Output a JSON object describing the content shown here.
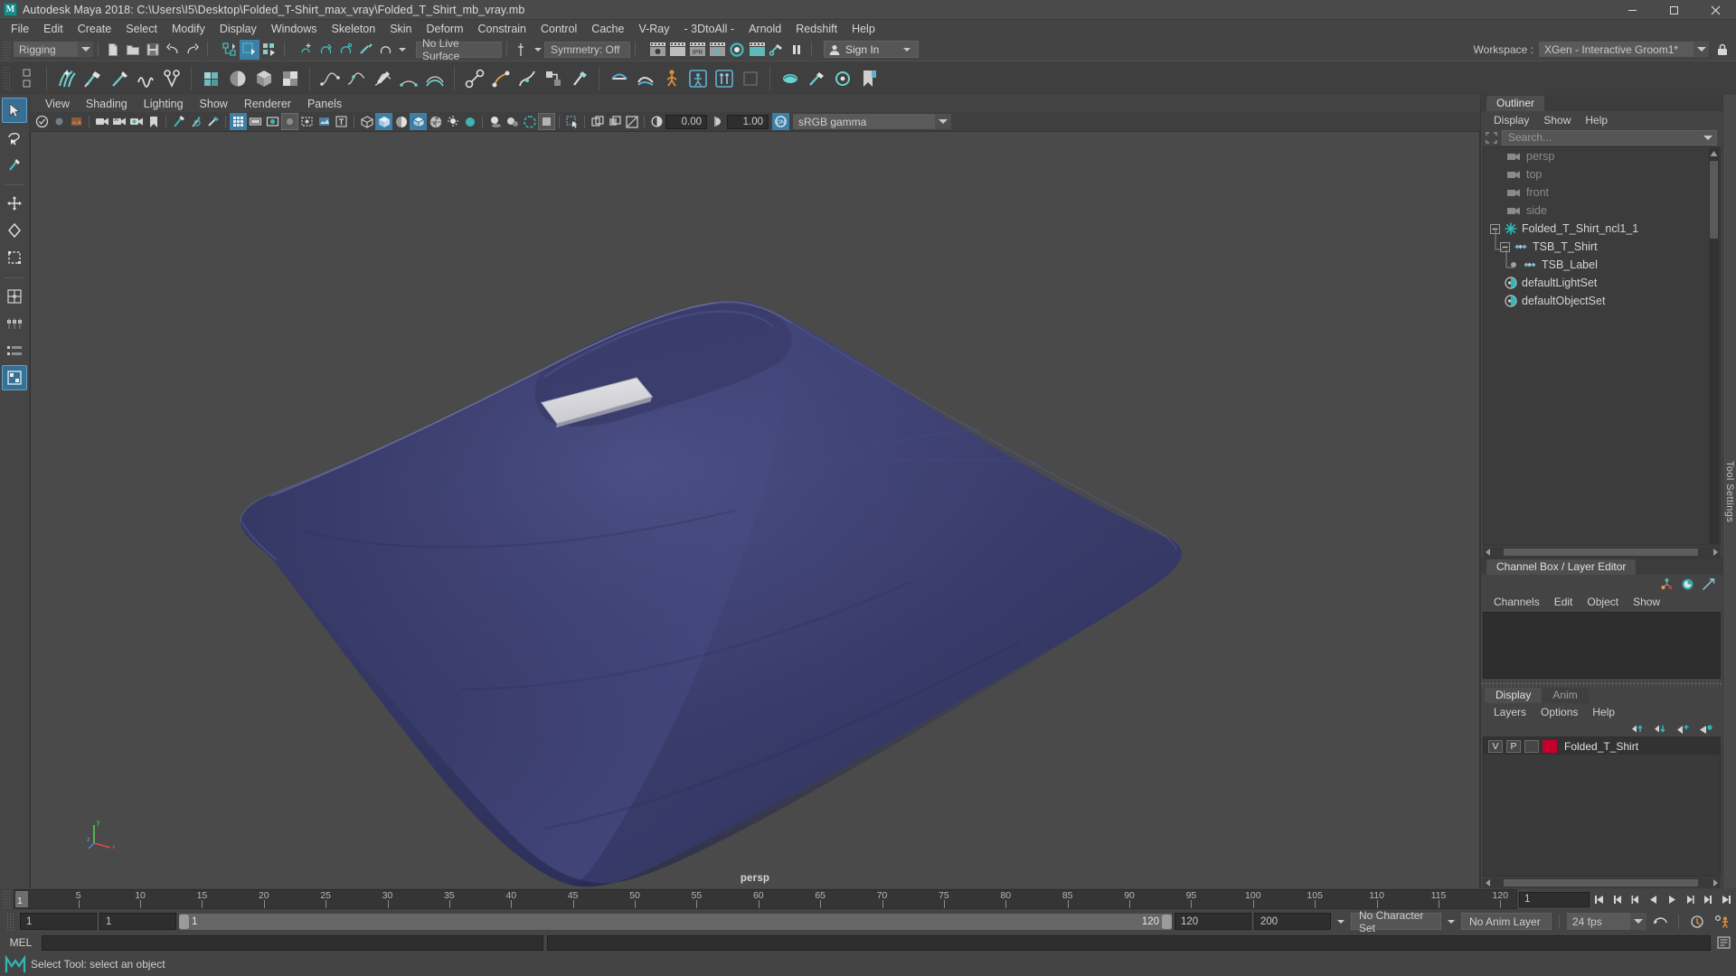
{
  "window": {
    "title": "Autodesk Maya 2018: C:\\Users\\I5\\Desktop\\Folded_T-Shirt_max_vray\\Folded_T_Shirt_mb_vray.mb",
    "logo": "M",
    "minimize": "minimize-icon",
    "maximize": "maximize-icon",
    "close": "close-icon"
  },
  "menubar": {
    "items": [
      "File",
      "Edit",
      "Create",
      "Select",
      "Modify",
      "Display",
      "Windows",
      "Skeleton",
      "Skin",
      "Deform",
      "Constrain",
      "Control",
      "Cache",
      "V-Ray",
      "- 3DtoAll -",
      "Arnold",
      "Redshift",
      "Help"
    ]
  },
  "statusline": {
    "menu_set": "Rigging",
    "live_surface": "No Live Surface",
    "symmetry": "Symmetry: Off",
    "sign_in": "Sign In",
    "workspace_label": "Workspace :",
    "workspace_value": "XGen - Interactive Groom1*"
  },
  "viewport": {
    "menus": [
      "View",
      "Shading",
      "Lighting",
      "Show",
      "Renderer",
      "Panels"
    ],
    "exposure": "0.00",
    "gamma": "1.00",
    "color_management": "sRGB gamma",
    "camera_label": "persp",
    "axis": {
      "x": "x",
      "y": "y",
      "z": "z"
    }
  },
  "outliner": {
    "tab": "Outliner",
    "menus": [
      "Display",
      "Show",
      "Help"
    ],
    "search_placeholder": "Search...",
    "items": [
      {
        "label": "persp",
        "icon": "camera-icon",
        "dim": true,
        "indent": 0
      },
      {
        "label": "top",
        "icon": "camera-icon",
        "dim": true,
        "indent": 0
      },
      {
        "label": "front",
        "icon": "camera-icon",
        "dim": true,
        "indent": 0
      },
      {
        "label": "side",
        "icon": "camera-icon",
        "dim": true,
        "indent": 0
      },
      {
        "label": "Folded_T_Shirt_ncl1_1",
        "icon": "nucleus-icon",
        "dim": false,
        "indent": 0
      },
      {
        "label": "TSB_T_Shirt",
        "icon": "mesh-icon",
        "dim": false,
        "indent": 1
      },
      {
        "label": "TSB_Label",
        "icon": "mesh-icon",
        "dim": false,
        "indent": 2
      },
      {
        "label": "defaultLightSet",
        "icon": "set-icon",
        "dim": false,
        "indent": 0
      },
      {
        "label": "defaultObjectSet",
        "icon": "set-icon",
        "dim": false,
        "indent": 0
      }
    ]
  },
  "channelbox": {
    "tab": "Channel Box / Layer Editor",
    "menus": [
      "Channels",
      "Edit",
      "Object",
      "Show"
    ]
  },
  "layereditor": {
    "tabs": [
      {
        "label": "Display",
        "active": true
      },
      {
        "label": "Anim",
        "active": false
      }
    ],
    "menus": [
      "Layers",
      "Options",
      "Help"
    ],
    "layers": [
      {
        "visible": "V",
        "playback": "P",
        "shade": "",
        "color": "#c4002b",
        "name": "Folded_T_Shirt"
      }
    ]
  },
  "toolsettings": {
    "label": "Tool Settings"
  },
  "timeslider": {
    "current_frame": "1",
    "ticks": [
      {
        "v": "5",
        "f": 5
      },
      {
        "v": "10",
        "f": 10
      },
      {
        "v": "15",
        "f": 15
      },
      {
        "v": "20",
        "f": 20
      },
      {
        "v": "25",
        "f": 25
      },
      {
        "v": "30",
        "f": 30
      },
      {
        "v": "35",
        "f": 35
      },
      {
        "v": "40",
        "f": 40
      },
      {
        "v": "45",
        "f": 45
      },
      {
        "v": "50",
        "f": 50
      },
      {
        "v": "55",
        "f": 55
      },
      {
        "v": "60",
        "f": 60
      },
      {
        "v": "65",
        "f": 65
      },
      {
        "v": "70",
        "f": 70
      },
      {
        "v": "75",
        "f": 75
      },
      {
        "v": "80",
        "f": 80
      },
      {
        "v": "85",
        "f": 85
      },
      {
        "v": "90",
        "f": 90
      },
      {
        "v": "95",
        "f": 95
      },
      {
        "v": "100",
        "f": 100
      },
      {
        "v": "105",
        "f": 105
      },
      {
        "v": "110",
        "f": 110
      },
      {
        "v": "115",
        "f": 115
      },
      {
        "v": "120",
        "f": 120
      }
    ],
    "range_start": 1,
    "range_end": 121,
    "playback_field": "1"
  },
  "rangeslider": {
    "anim_start": "1",
    "range_start": "1",
    "bar_start": "1",
    "bar_end": "120",
    "range_end": "120",
    "anim_end": "200",
    "character_set": "No Character Set",
    "anim_layer": "No Anim Layer",
    "fps": "24 fps"
  },
  "commandline": {
    "label": "MEL",
    "input_value": "",
    "output_value": ""
  },
  "helpline": {
    "text": "Select Tool: select an object"
  },
  "colors": {
    "accent_teal": "#3fb3b3",
    "active_blue": "#3e7fa8",
    "layer_red": "#c4002b",
    "shirt_navy": "#3a3c6e",
    "bg_panel": "#444444",
    "viewport_bg": "#4a4a4a"
  }
}
